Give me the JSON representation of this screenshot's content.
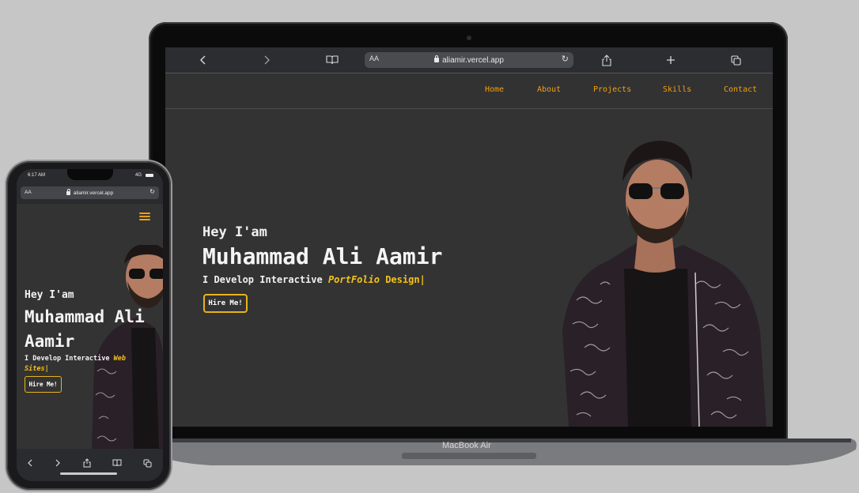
{
  "laptop": {
    "browser": {
      "url_aa": "AA",
      "url": "aliamir.vercel.app",
      "icons": [
        "chevron-left-icon",
        "chevron-right-icon",
        "book-icon",
        "reload-icon",
        "share-icon",
        "plus-icon",
        "tabs-icon"
      ]
    },
    "nav": [
      "Home",
      "About",
      "Projects",
      "Skills",
      "Contact"
    ],
    "hero": {
      "greeting": "Hey I'am",
      "name": "Muhammad Ali Aamir",
      "tag_prefix": "I Develop Interactive ",
      "tag_highlight": "PortFolio",
      "tag_suffix": " Design|",
      "button": "Hire Me!"
    },
    "model_label": "MacBook Air"
  },
  "phone": {
    "status": {
      "time": "6:17 AM",
      "signal": "4G"
    },
    "url_aa": "AA",
    "url": "aliamir.vercel.app",
    "hero": {
      "greeting": "Hey I'am",
      "name": "Muhammad Ali Aamir",
      "tag_prefix": "I Develop Interactive ",
      "tag_highlight": "Web Sites|",
      "button": "Hire Me!"
    }
  },
  "colors": {
    "accent": "#f0a012",
    "highlight": "#f4c21b",
    "page_bg": "#333333",
    "backdrop": "#c6c6c6"
  }
}
